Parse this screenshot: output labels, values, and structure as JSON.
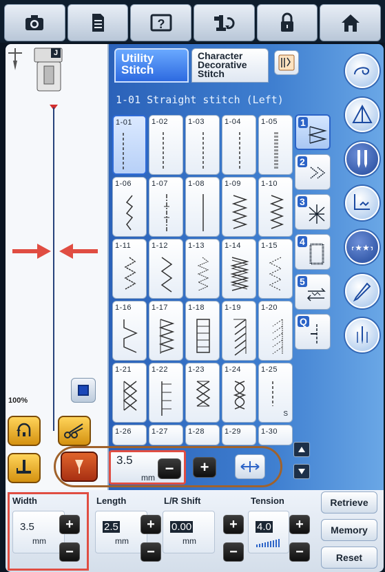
{
  "toolbar": {
    "items": [
      {
        "name": "camera-icon"
      },
      {
        "name": "document-icon"
      },
      {
        "name": "help-icon",
        "label": "?"
      },
      {
        "name": "presser-foot-icon"
      },
      {
        "name": "lock-icon"
      },
      {
        "name": "home-icon"
      }
    ]
  },
  "tabs": {
    "utility": "Utility Stitch",
    "utility_line1": "Utility",
    "utility_line2": "Stitch",
    "character_line1": "Character",
    "character_line2": "Decorative",
    "character_line3": "Stitch"
  },
  "presser_foot_label": "J",
  "selected_stitch_title": "1-01 Straight stitch (Left)",
  "stitches": [
    {
      "id": "1-01",
      "selected": true
    },
    {
      "id": "1-02"
    },
    {
      "id": "1-03"
    },
    {
      "id": "1-04"
    },
    {
      "id": "1-05"
    },
    {
      "id": "1-06"
    },
    {
      "id": "1-07"
    },
    {
      "id": "1-08"
    },
    {
      "id": "1-09"
    },
    {
      "id": "1-10"
    },
    {
      "id": "1-11"
    },
    {
      "id": "1-12"
    },
    {
      "id": "1-13"
    },
    {
      "id": "1-14"
    },
    {
      "id": "1-15"
    },
    {
      "id": "1-16"
    },
    {
      "id": "1-17"
    },
    {
      "id": "1-18"
    },
    {
      "id": "1-19"
    },
    {
      "id": "1-20"
    },
    {
      "id": "1-21"
    },
    {
      "id": "1-22"
    },
    {
      "id": "1-23"
    },
    {
      "id": "1-24"
    },
    {
      "id": "1-25",
      "extra": "S"
    },
    {
      "id": "1-26"
    },
    {
      "id": "1-27"
    },
    {
      "id": "1-28"
    },
    {
      "id": "1-29"
    },
    {
      "id": "1-30"
    }
  ],
  "categories": [
    "1",
    "2",
    "3",
    "4",
    "5",
    "Q"
  ],
  "zoom": "100%",
  "width_quick": {
    "value": "3.5",
    "unit": "mm"
  },
  "settings": {
    "width": {
      "label": "Width",
      "value": "3.5",
      "unit": "mm"
    },
    "length": {
      "label": "Length",
      "value": "2.5",
      "unit": "mm"
    },
    "shift": {
      "label": "L/R Shift",
      "value": "0.00",
      "unit": "mm"
    },
    "tension": {
      "label": "Tension",
      "value": "4.0"
    }
  },
  "side_buttons": {
    "retrieve": "Retrieve",
    "memory": "Memory",
    "reset": "Reset"
  },
  "colors": {
    "accent": "#2b63c7",
    "highlight": "#e04d42",
    "orange": "#a0622b"
  }
}
